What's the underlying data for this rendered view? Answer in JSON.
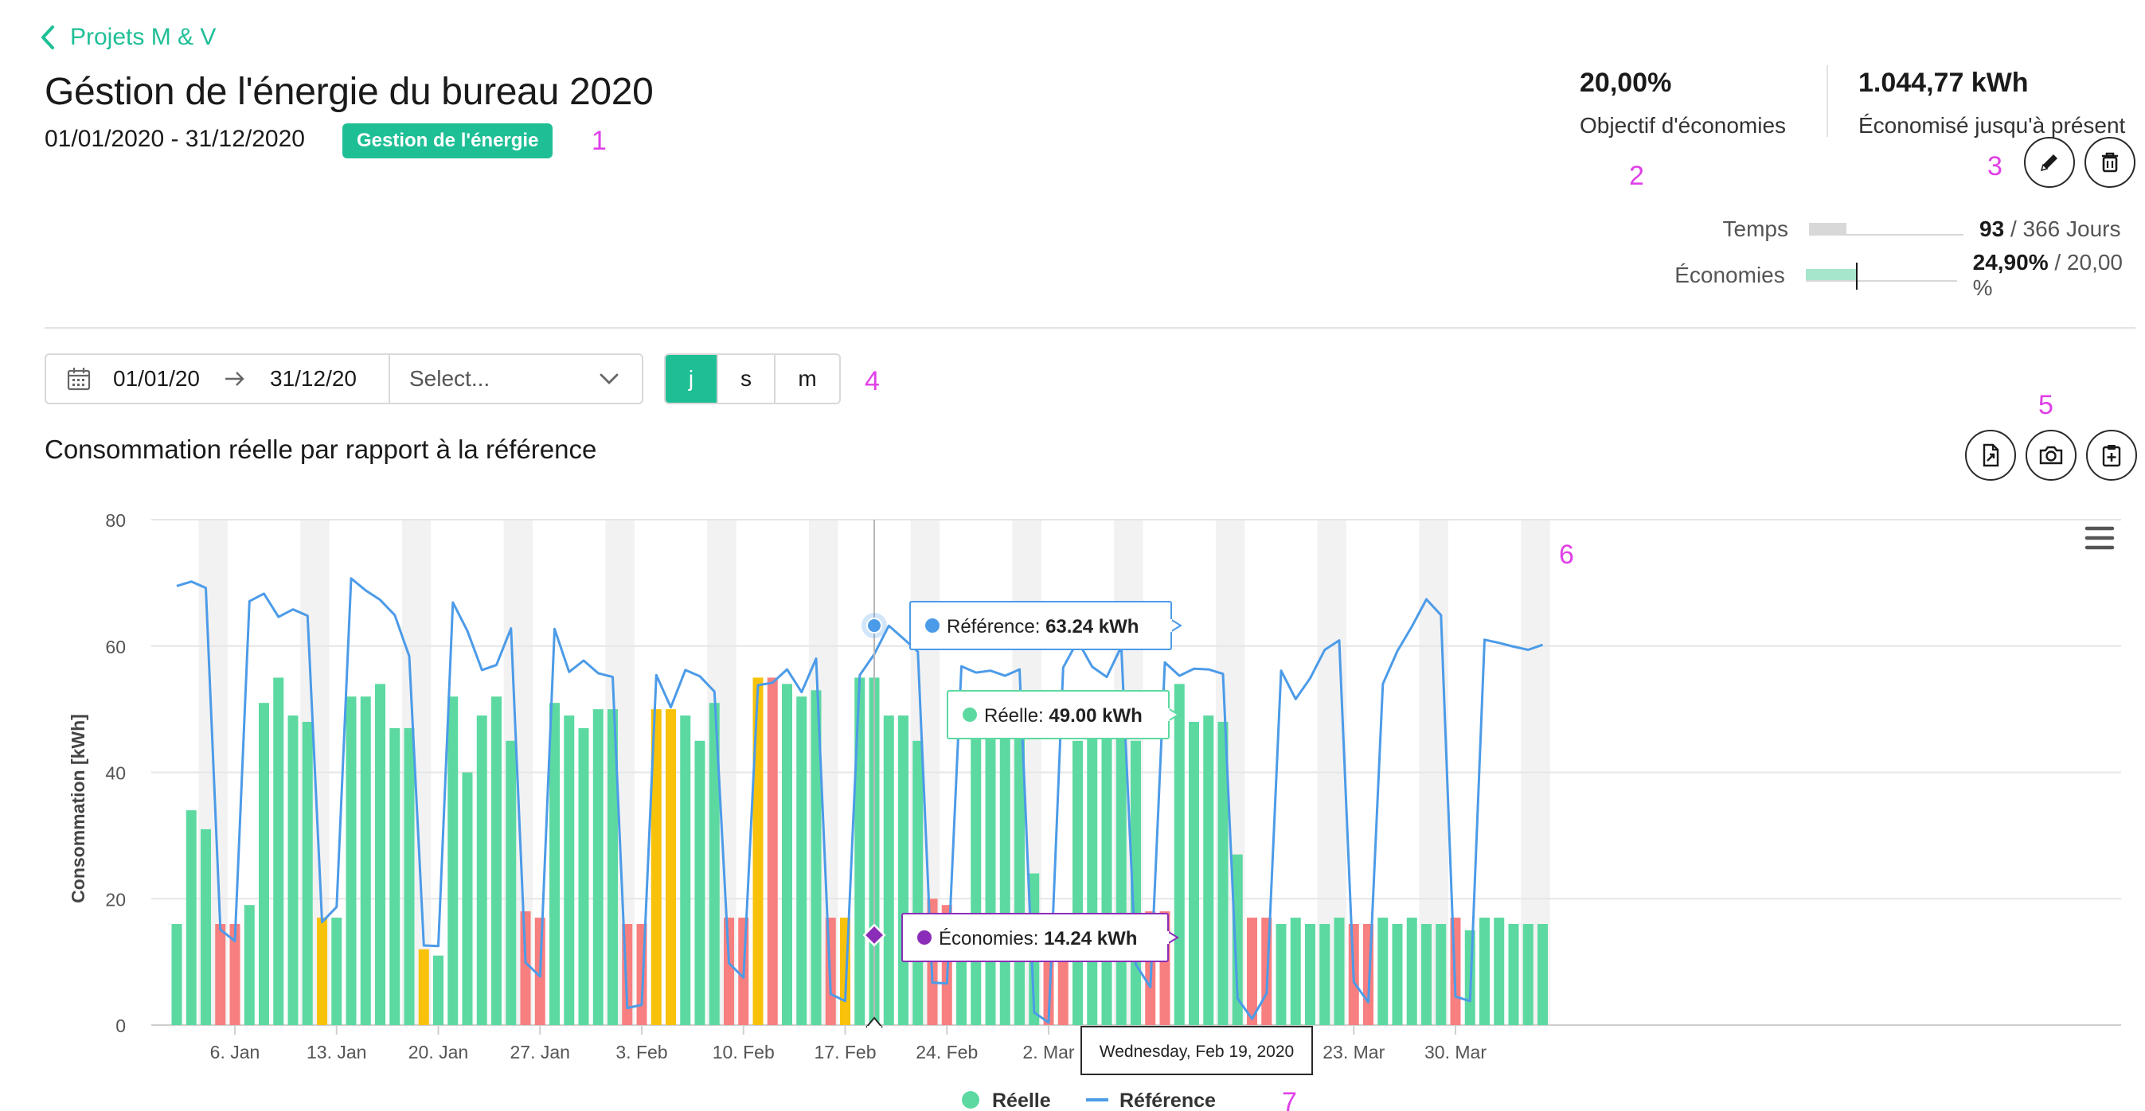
{
  "breadcrumb": {
    "label": "Projets M & V"
  },
  "header": {
    "title": "Géstion de l'énergie du bureau 2020",
    "date_range": "01/01/2020 - 31/12/2020",
    "tag": "Gestion de l'énergie"
  },
  "stats": {
    "goal": {
      "value": "20,00%",
      "label": "Objectif d'économies"
    },
    "saved": {
      "value": "1.044,77 kWh",
      "label": "Économisé jusqu'à présent"
    }
  },
  "progress": {
    "time": {
      "label": "Temps",
      "value": "93",
      "total": "/ 366 Jours",
      "fraction": 0.254
    },
    "savings": {
      "label": "Économies",
      "value": "24,90%",
      "total": "/ 20,00 %",
      "fraction": 0.249,
      "target_fraction": 0.2
    }
  },
  "markers": [
    "1",
    "2",
    "3",
    "4",
    "5",
    "6",
    "7"
  ],
  "filters": {
    "start": "01/01/20",
    "end": "31/12/20",
    "select_placeholder": "Select...",
    "granularity": [
      "j",
      "s",
      "m"
    ],
    "active_granularity": "j"
  },
  "icons": {
    "back": "chevron-left-icon",
    "edit": "pencil-icon",
    "delete": "trash-icon",
    "calendar": "calendar-icon",
    "range_arrow": "arrow-right-icon",
    "dropdown": "chevron-down-icon",
    "export": "file-export-icon",
    "snapshot": "camera-icon",
    "clipboard": "clipboard-plus-icon",
    "menu": "hamburger-menu-icon"
  },
  "colors": {
    "accent": "#1fbf96",
    "bar_normal": "#5cd9a1",
    "bar_over": "#f77f7f",
    "bar_warn": "#f8c20a",
    "line": "#4c9be8",
    "savings": "#8b2db8"
  },
  "chart": {
    "title": "Consommation réelle par rapport à la référence",
    "tooltip": {
      "reference_label": "Référence:",
      "reference_value": "63.24 kWh",
      "reelle_label": "Réelle:",
      "reelle_value": "49.00 kWh",
      "savings_label": "Économies:",
      "savings_value": "14.24 kWh",
      "date": "Wednesday, Feb 19, 2020"
    }
  },
  "chart_data": {
    "type": "bar",
    "ylabel": "Consommation [kWh]",
    "ylim": [
      0,
      80
    ],
    "yticks": [
      0,
      20,
      40,
      60,
      80
    ],
    "xticks": [
      "6. Jan",
      "13. Jan",
      "20. Jan",
      "27. Jan",
      "3. Feb",
      "10. Feb",
      "17. Feb",
      "24. Feb",
      "2. Mar",
      "9. Mar",
      "16. Mar",
      "23. Mar",
      "30. Mar"
    ],
    "x_start": "2020-01-02",
    "legend": [
      "Réelle",
      "Référence"
    ],
    "series": [
      {
        "name": "Réelle",
        "values": [
          16,
          34,
          31,
          16,
          16,
          19,
          51,
          55,
          49,
          48,
          17,
          17,
          52,
          52,
          54,
          47,
          47,
          12,
          11,
          52,
          40,
          49,
          52,
          45,
          18,
          17,
          51,
          49,
          47,
          50,
          50,
          16,
          16,
          50,
          50,
          49,
          45,
          51,
          17,
          17,
          55,
          55,
          54,
          52,
          53,
          17,
          17,
          55,
          55,
          49,
          49,
          45,
          20,
          19,
          16,
          53,
          52,
          52,
          52,
          24,
          17,
          17,
          45,
          50,
          47,
          46,
          45,
          18,
          18,
          54,
          48,
          49,
          48,
          27,
          17,
          17,
          16,
          17,
          16,
          16,
          17,
          16,
          16,
          17,
          16,
          17,
          16,
          16,
          17,
          15,
          17,
          17,
          16,
          16,
          16
        ]
      },
      {
        "name": "Référence",
        "values": [
          69.5,
          70.2,
          69.2,
          15.1,
          13.3,
          67.1,
          68.3,
          64.6,
          65.8,
          64.8,
          16.3,
          18.7,
          70.7,
          68.8,
          67.3,
          64.9,
          58.4,
          12.6,
          12.5,
          66.9,
          62.4,
          56.2,
          57.0,
          62.8,
          9.9,
          7.7,
          62.7,
          55.9,
          57.7,
          55.7,
          55.1,
          2.7,
          3.2,
          55.4,
          50.3,
          56.2,
          55.2,
          52.8,
          9.8,
          7.5,
          53.8,
          54.2,
          56.3,
          52.7,
          58.0,
          4.9,
          3.8,
          55.4,
          58.7,
          63.2,
          61.2,
          59.1,
          6.7,
          6.6,
          56.8,
          55.8,
          56.1,
          55.3,
          56.3,
          2.0,
          0.4,
          56.6,
          60.8,
          56.7,
          55.1,
          59.9,
          9.6,
          6.0,
          57.4,
          55.3,
          56.4,
          56.3,
          55.6,
          4.2,
          1.0,
          5.0,
          56.1,
          51.6,
          54.9,
          59.4,
          60.9,
          6.8,
          3.6,
          54.0,
          59.2,
          63.1,
          67.4,
          64.9,
          4.5,
          3.8,
          61.0,
          60.5,
          59.9,
          59.4,
          60.2
        ]
      }
    ],
    "bar_status": "n n n o o n n n n n w n n n n n n w n n n n n n o o n n n n n o o w w n n n o o w o n n n o w n n n n n o o n n n n n n o o n n n n n o o n n n n n o o n n n n n o o n n n n n o n n n n n n",
    "highlight": {
      "date": "Wednesday, Feb 19, 2020",
      "reelle": 49.0,
      "reference": 63.24,
      "savings": 14.24
    }
  }
}
